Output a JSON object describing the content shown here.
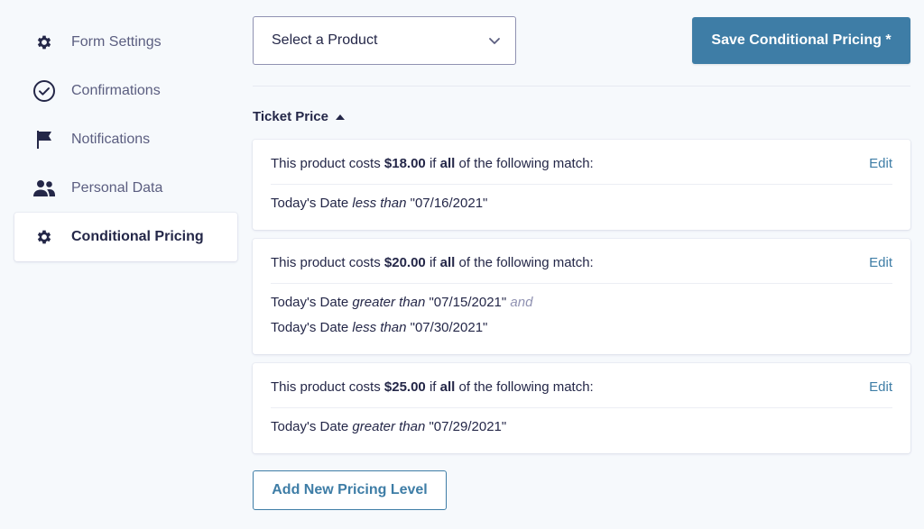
{
  "sidebar": {
    "items": [
      {
        "label": "Form Settings",
        "icon": "gear-icon"
      },
      {
        "label": "Confirmations",
        "icon": "check-circle-icon"
      },
      {
        "label": "Notifications",
        "icon": "flag-icon"
      },
      {
        "label": "Personal Data",
        "icon": "users-icon"
      },
      {
        "label": "Conditional Pricing",
        "icon": "gear-icon",
        "active": true
      }
    ]
  },
  "toolbar": {
    "product_select": "Select a Product",
    "save_label": "Save Conditional Pricing *"
  },
  "section": {
    "title": "Ticket Price"
  },
  "pricing_levels": [
    {
      "prefix": "This product costs ",
      "price": "$18.00",
      "mid": " if ",
      "match": "all",
      "suffix": " of the following match:",
      "edit": "Edit",
      "conditions": [
        {
          "field": "Today's Date",
          "operator": "less than",
          "value": "\"07/16/2021\""
        }
      ]
    },
    {
      "prefix": "This product costs ",
      "price": "$20.00",
      "mid": " if ",
      "match": "all",
      "suffix": " of the following match:",
      "edit": "Edit",
      "conditions": [
        {
          "field": "Today's Date",
          "operator": "greater than",
          "value": "\"07/15/2021\"",
          "joiner": "and"
        },
        {
          "field": "Today's Date",
          "operator": "less than",
          "value": "\"07/30/2021\""
        }
      ]
    },
    {
      "prefix": "This product costs ",
      "price": "$25.00",
      "mid": " if ",
      "match": "all",
      "suffix": " of the following match:",
      "edit": "Edit",
      "conditions": [
        {
          "field": "Today's Date",
          "operator": "greater than",
          "value": "\"07/29/2021\""
        }
      ]
    }
  ],
  "add_button": "Add New Pricing Level",
  "colors": {
    "accent": "#3e7da6",
    "text": "#242748",
    "muted": "#5b5e80",
    "background": "#f6f9fc"
  }
}
